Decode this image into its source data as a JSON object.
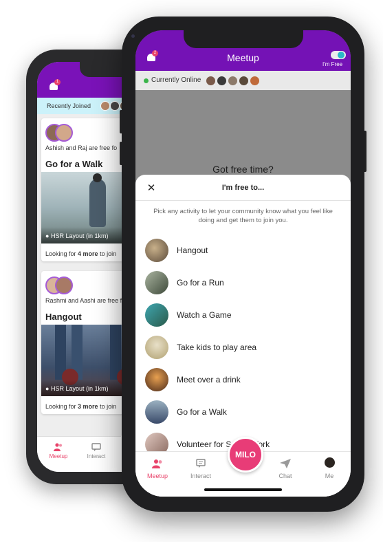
{
  "back_phone": {
    "notification_count": "1",
    "recently_joined_label": "Recently Joined",
    "cards": [
      {
        "names_a": "Ashish",
        "and_text": "and",
        "names_b": "Raj",
        "free_text": "are free fo",
        "title": "Go for a Walk",
        "location": "HSR Layout (in 1km)",
        "looking_prefix": "Looking for",
        "looking_count": "4 more",
        "looking_suffix": "to join"
      },
      {
        "names_a": "Rashmi",
        "and_text": "and",
        "names_b": "Aashi",
        "free_text": "are free fo",
        "title": "Hangout",
        "location": "HSR Layout (in 1km)",
        "looking_prefix": "Looking for",
        "looking_count": "3 more",
        "looking_suffix": "to join"
      }
    ],
    "tabs": [
      {
        "label": "Meetup",
        "active": true
      },
      {
        "label": "Interact",
        "active": false
      }
    ]
  },
  "front_phone": {
    "header": {
      "title": "Meetup",
      "notification_count": "2",
      "toggle_label": "I'm Free",
      "toggle_on": true
    },
    "online": {
      "label": "Currently Online",
      "avatar_count": 5
    },
    "background_text": "Got free time?",
    "sheet": {
      "title": "I'm free to...",
      "description": "Pick any activity to let your community know what you feel like doing and get them to join you.",
      "activities": [
        {
          "label": "Hangout",
          "icon": "hangout-photo"
        },
        {
          "label": "Go for a Run",
          "icon": "run-photo"
        },
        {
          "label": "Watch a Game",
          "icon": "game-photo"
        },
        {
          "label": "Take kids to play area",
          "icon": "kids-photo"
        },
        {
          "label": "Meet over a drink",
          "icon": "drink-photo"
        },
        {
          "label": "Go for a Walk",
          "icon": "walk-photo"
        },
        {
          "label": "Volunteer for Social Work",
          "icon": "volunteer-photo"
        }
      ]
    },
    "tabs": [
      {
        "label": "Meetup",
        "icon": "people-icon",
        "active": true
      },
      {
        "label": "Interact",
        "icon": "chat-bubble-icon",
        "active": false
      },
      {
        "label": "MILO",
        "icon": "milo-button",
        "active": false
      },
      {
        "label": "Chat",
        "icon": "paper-plane-icon",
        "active": false
      },
      {
        "label": "Me",
        "icon": "avatar",
        "active": false
      }
    ]
  },
  "colors": {
    "brand_purple": "#7412b5",
    "accent_pink": "#e83c77",
    "online_green": "#3ab54a",
    "toggle_teal": "#2bb6c8"
  }
}
